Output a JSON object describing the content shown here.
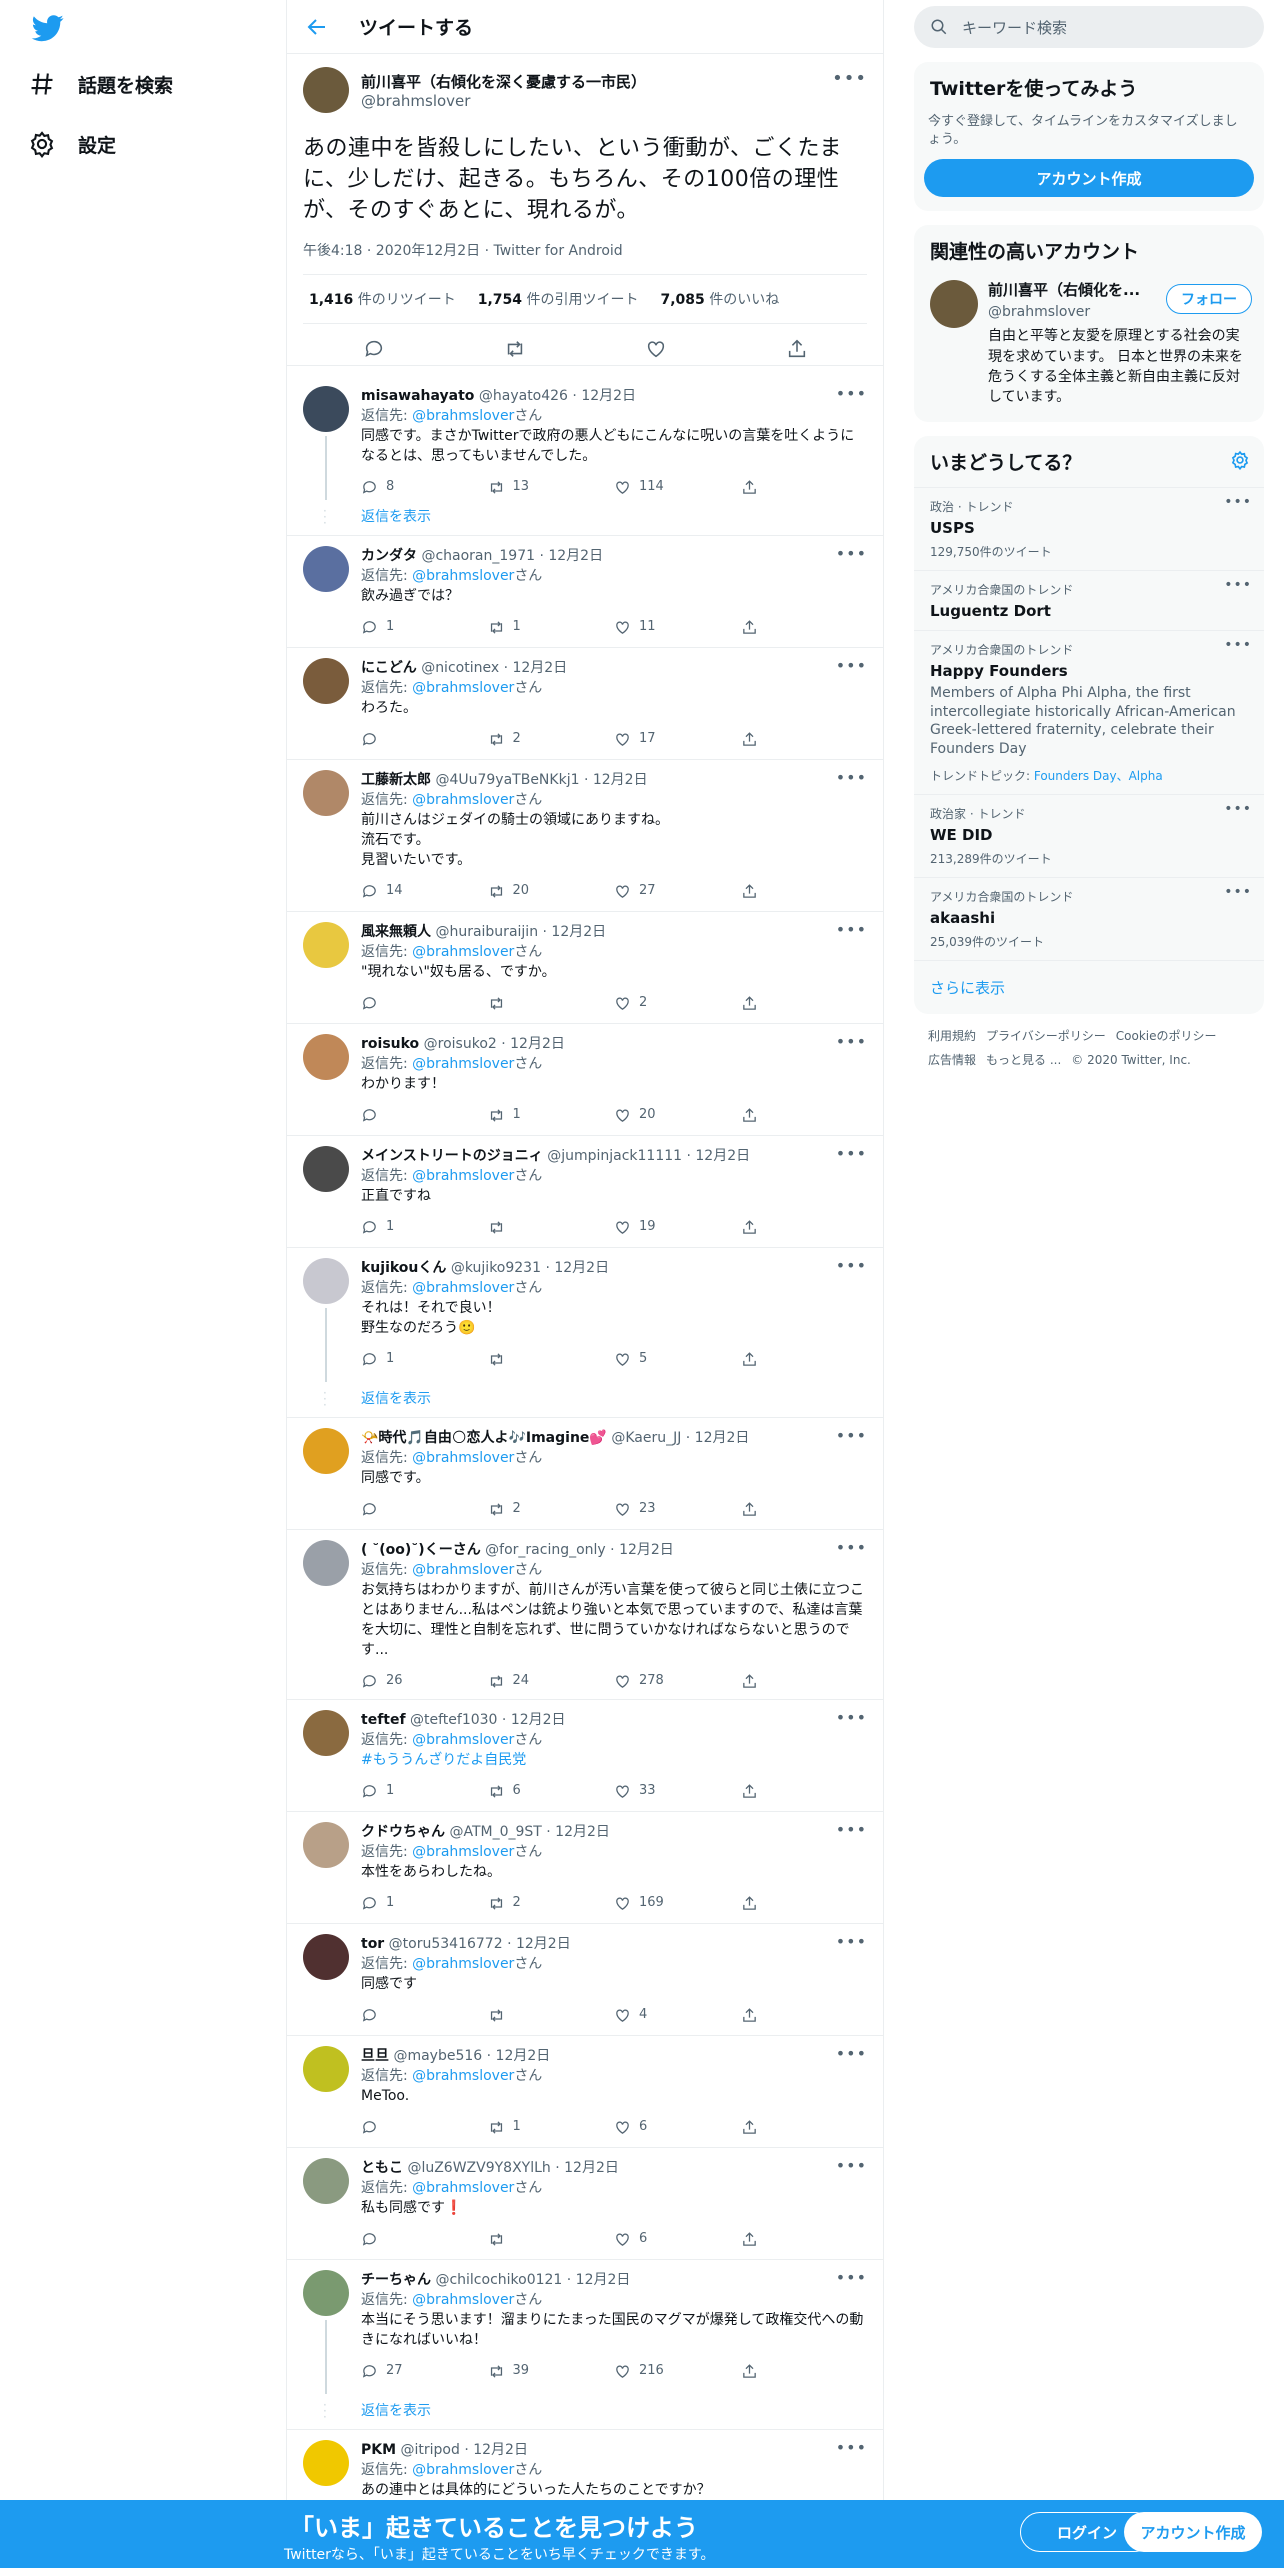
{
  "colors": {
    "accent": "#1d9bf0",
    "muted": "#536471"
  },
  "nav": {
    "explore": "話題を検索",
    "settings": "設定"
  },
  "header": {
    "title": "ツイートする"
  },
  "focus": {
    "name": "前川喜平（右傾化を深く憂慮する一市民）",
    "handle": "@brahmslover",
    "text": "あの連中を皆殺しにしたい、という衝動が、ごくたまに、少しだけ、起きる。もちろん、その100倍の理性が、そのすぐあとに、現れるが。",
    "meta": "午後4:18 · 2020年12月2日 · Twitter for Android",
    "retweets": "1,416",
    "retweets_label": " 件のリツイート",
    "quotes": "1,754",
    "quotes_label": " 件の引用ツイート",
    "likes": "7,085",
    "likes_label": " 件のいいね"
  },
  "reply_prefix": "返信先: ",
  "reply_to": "@brahmslover",
  "reply_suffix": "さん",
  "show_replies": "返信を表示",
  "replies": [
    {
      "name": "misawahayato",
      "handle": "@hayato426",
      "date": " · 12月2日",
      "text": "同感です。まさかTwitterで政府の悪人どもにこんなに呪いの言葉を吐くようになるとは、思ってもいませんでした。",
      "reply": "8",
      "rt": "13",
      "like": "114"
    },
    {
      "name": "カンダタ",
      "handle": "@chaoran_1971",
      "date": " · 12月2日",
      "text": "飲み過ぎでは？",
      "reply": "1",
      "rt": "1",
      "like": "11"
    },
    {
      "name": "にこどん",
      "handle": "@nicotinex",
      "date": " · 12月2日",
      "text": "わろた。",
      "reply": "",
      "rt": "2",
      "like": "17"
    },
    {
      "name": "工藤新太郎",
      "handle": "@4Uu79yaTBeNKkj1",
      "date": " · 12月2日",
      "text": "前川さんはジェダイの騎士の領域にありますね。\n流石です。\n見習いたいです。",
      "reply": "14",
      "rt": "20",
      "like": "27"
    },
    {
      "name": "風来無頼人",
      "handle": "@huraiburaijin",
      "date": " · 12月2日",
      "text": "\"現れない\"奴も居る、ですか。",
      "reply": "",
      "rt": "",
      "like": "2"
    },
    {
      "name": "roisuko",
      "handle": "@roisuko2",
      "date": " · 12月2日",
      "text": "わかります！",
      "reply": "",
      "rt": "1",
      "like": "20"
    },
    {
      "name": "メインストリートのジョニィ",
      "handle": "@jumpinjack11111",
      "date": " · 12月2日",
      "text": "正直ですね",
      "reply": "1",
      "rt": "",
      "like": "19"
    },
    {
      "name": "kujikouくん",
      "handle": "@kujiko9231",
      "date": " · 12月2日",
      "text": "それは！それで良い！\n野生なのだろう🙂",
      "reply": "1",
      "rt": "",
      "like": "5"
    },
    {
      "name": "📯時代🎵自由🌕恋人よ🎶Imagine💕",
      "handle": "@Kaeru_JJ",
      "date": " · 12月2日",
      "text": "同感です。",
      "reply": "",
      "rt": "2",
      "like": "23"
    },
    {
      "name": "( ˘(oo)˘)くーさん",
      "handle": "@for_racing_only",
      "date": " · 12月2日",
      "text": "お気持ちはわかりますが、前川さんが汚い言葉を使って彼らと同じ土俵に立つことはありません...私はペンは銃より強いと本気で思っていますので、私達は言葉を大切に、理性と自制を忘れず、世に問うていかなければならないと思うのです...",
      "reply": "26",
      "rt": "24",
      "like": "278"
    },
    {
      "name": "teftef",
      "handle": "@teftef1030",
      "date": " · 12月2日",
      "text": "#もううんざりだよ自民党",
      "reply": "1",
      "rt": "6",
      "like": "33"
    },
    {
      "name": "クドウちゃん",
      "handle": "@ATM_0_9ST",
      "date": " · 12月2日",
      "text": "本性をあらわしたね。",
      "reply": "1",
      "rt": "2",
      "like": "169"
    },
    {
      "name": "tor",
      "handle": "@toru53416772",
      "date": " · 12月2日",
      "text": "同感です",
      "reply": "",
      "rt": "",
      "like": "4"
    },
    {
      "name": "旦旦",
      "handle": "@maybe516",
      "date": " · 12月2日",
      "text": "MeToo.",
      "reply": "",
      "rt": "1",
      "like": "6"
    },
    {
      "name": "ともこ",
      "handle": "@luZ6WZV9Y8XYlLh",
      "date": " · 12月2日",
      "text": "私も同感です❗",
      "reply": "",
      "rt": "",
      "like": "6"
    },
    {
      "name": "チーちゃん",
      "handle": "@chilcochiko0121",
      "date": " · 12月2日",
      "text": "本当にそう思います！溜まりにたまった国民のマグマが爆発して政権交代への動きになればいいね！",
      "reply": "27",
      "rt": "39",
      "like": "216"
    },
    {
      "name": "PKM",
      "handle": "@itripod",
      "date": " · 12月2日",
      "text": "あの連中とは具体的にどういった人たちのことですか？",
      "reply": "",
      "rt": "",
      "like": ""
    }
  ],
  "right": {
    "search_placeholder": "キーワード検索",
    "signup_title": "Twitterを使ってみよう",
    "signup_desc": "今すぐ登録して、タイムラインをカスタマイズしましょう。",
    "signup_btn": "アカウント作成",
    "rel_title": "関連性の高いアカウント",
    "rel_name": "前川喜平（右傾化を...",
    "rel_handle": "@brahmslover",
    "rel_bio": "自由と平等と友愛を原理とする社会の実現を求めています。 日本と世界の未来を危うくする全体主義と新自由主義に反対しています。",
    "follow_btn": "フォロー",
    "trends_title": "いまどうしてる？",
    "trends": [
      {
        "ctx": "政治 · トレンド",
        "title": "USPS",
        "count": "129,750件のツイート"
      },
      {
        "ctx": "アメリカ合衆国のトレンド",
        "title": "Luguentz Dort",
        "count": ""
      },
      {
        "ctx": "アメリカ合衆国のトレンド",
        "title": "Happy Founders",
        "desc": "Members of Alpha Phi Alpha, the first intercollegiate historically African-American Greek-lettered fraternity, celebrate their Founders Day",
        "topic_label": "トレンドトピック: ",
        "topic_links": "Founders Day、Alpha"
      },
      {
        "ctx": "政治家 · トレンド",
        "title": "WE DID",
        "count": "213,289件のツイート"
      },
      {
        "ctx": "アメリカ合衆国のトレンド",
        "title": "akaashi",
        "count": "25,039件のツイート"
      }
    ],
    "show_more": "さらに表示",
    "footer1": [
      "利用規約",
      "プライバシーポリシー",
      "Cookieのポリシー"
    ],
    "footer2": [
      "広告情報",
      "もっと見る ...",
      "© 2020 Twitter, Inc."
    ]
  },
  "bottom": {
    "headline": "「いま」起きていることを見つけよう",
    "sub": "Twitterなら、「いま」起きていることをいち早くチェックできます。",
    "login": "ログイン",
    "signup": "アカウント作成"
  }
}
